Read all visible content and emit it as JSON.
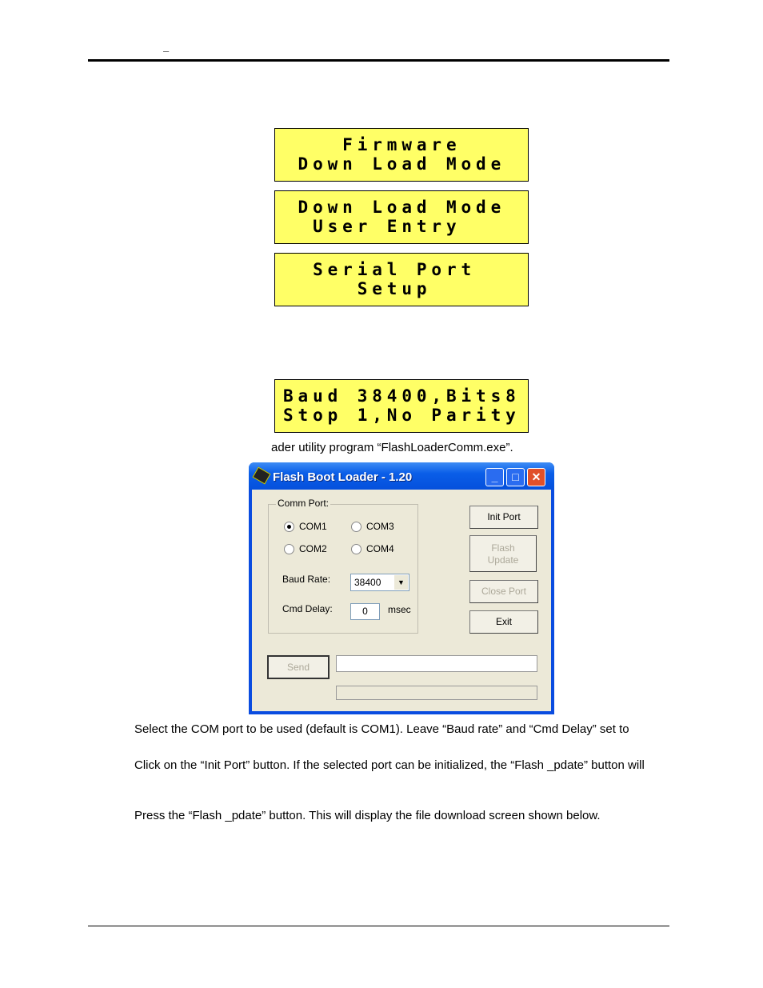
{
  "header": {
    "mark": "–"
  },
  "lcd_screens": [
    {
      "lines": [
        "    Firmware",
        " Down Load Mode"
      ]
    },
    {
      "lines": [
        " Down Load Mode",
        "  User Entry"
      ]
    },
    {
      "lines": [
        "  Serial Port",
        "     Setup"
      ]
    },
    {
      "lines": [
        "Baud 38400,Bits8",
        "Stop 1,No Parity"
      ]
    }
  ],
  "paragraphs": {
    "caption": "ader utility program “FlashLoaderComm.exe”.",
    "p1": "Select the COM port to be used (default is COM1). Leave “Baud rate” and “Cmd Delay” set to",
    "p2": "Click on the “Init Port” button. If the selected port can be initialized, the “Flash _pdate” button will",
    "p3": "Press the  “Flash _pdate” button. This will display the file download screen shown below."
  },
  "dialog": {
    "title": "Flash Boot Loader - 1.20",
    "group_label": "Comm Port:",
    "ports": [
      {
        "label": "COM1",
        "selected": true
      },
      {
        "label": "COM2",
        "selected": false
      },
      {
        "label": "COM3",
        "selected": false
      },
      {
        "label": "COM4",
        "selected": false
      }
    ],
    "baud_label": "Baud Rate:",
    "baud_value": "38400",
    "delay_label": "Cmd Delay:",
    "delay_value": "0",
    "delay_unit": "msec",
    "buttons": {
      "init": "Init Port",
      "flash1": "Flash",
      "flash2": "Update",
      "close": "Close Port",
      "exit": "Exit",
      "send": "Send"
    },
    "send_input": "",
    "progress": 0,
    "titlebar": {
      "min": "_",
      "max": "□",
      "close": "✕"
    }
  }
}
